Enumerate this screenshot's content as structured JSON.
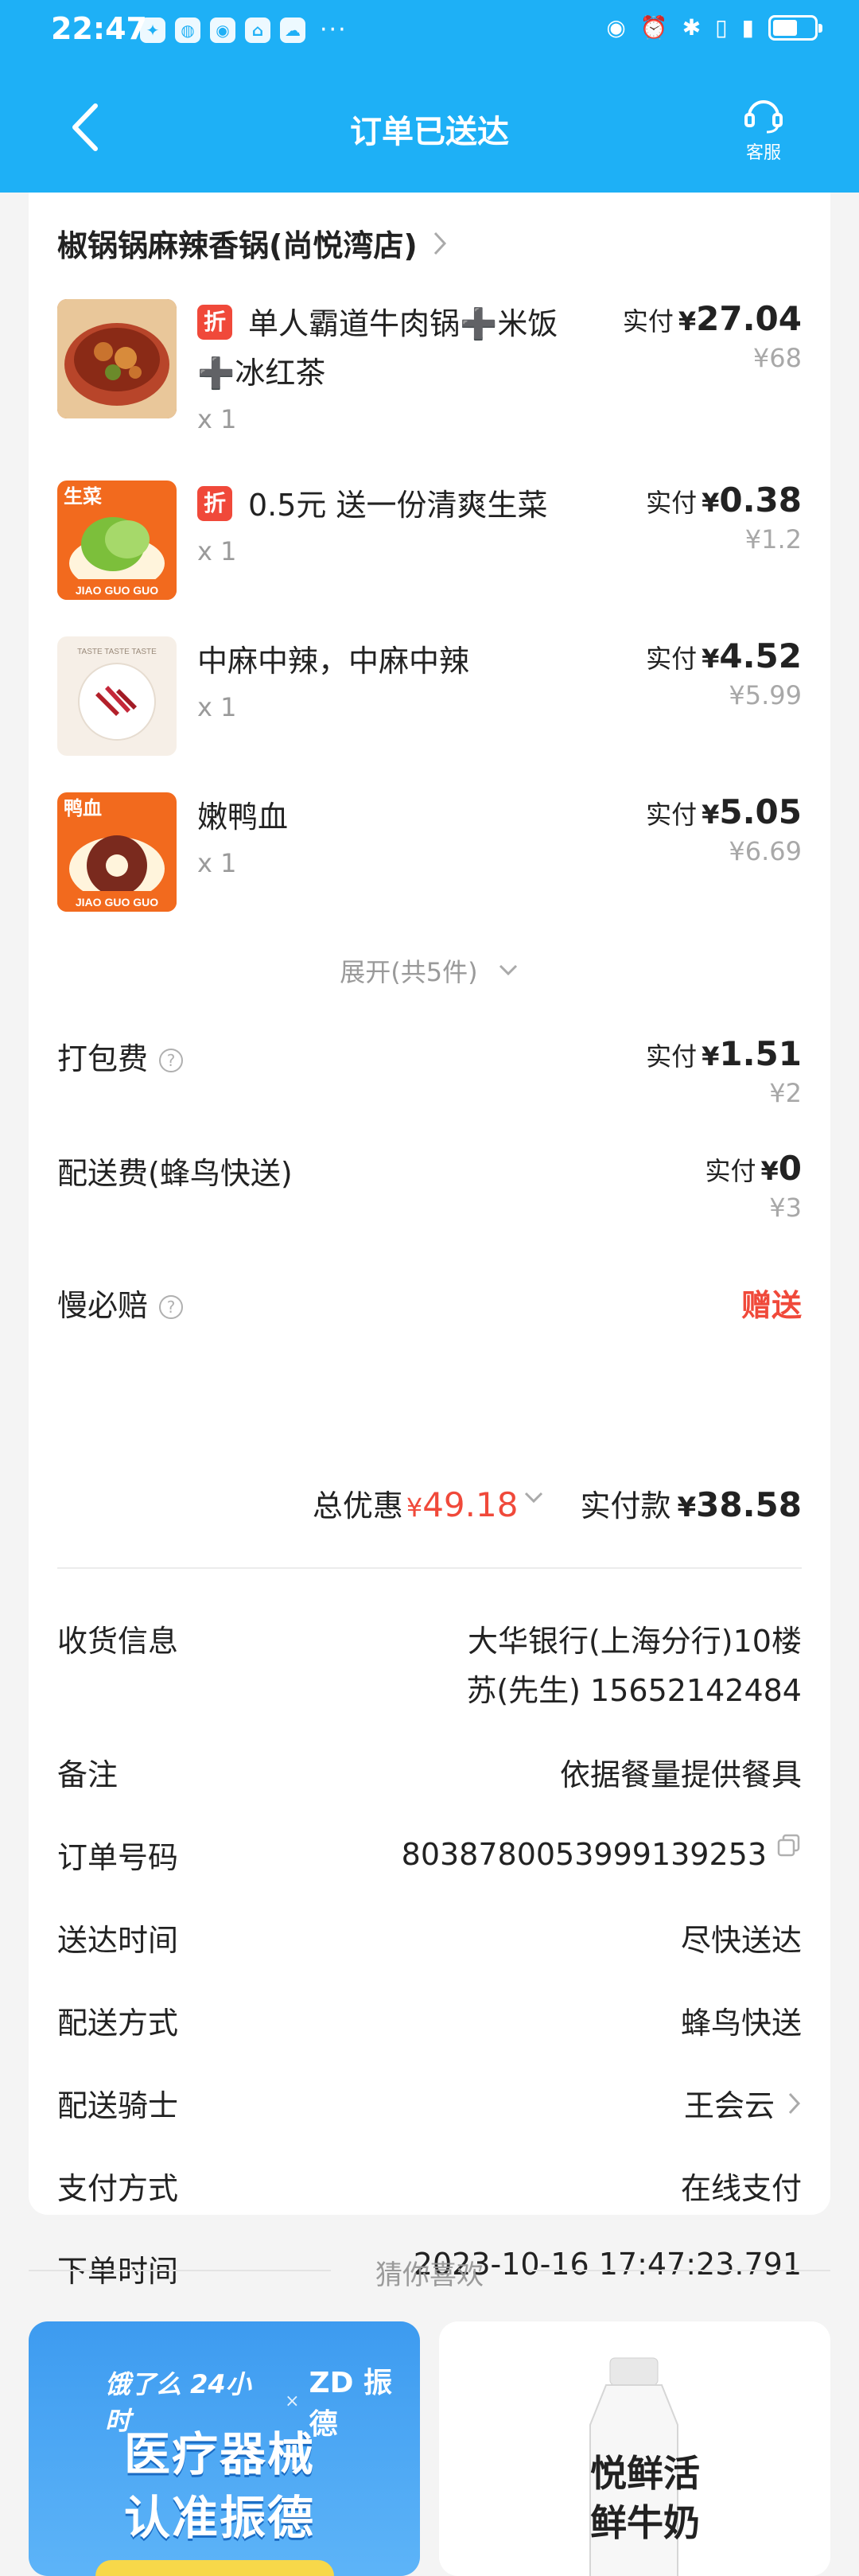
{
  "status_bar": {
    "time": "22:47",
    "left_icons": [
      "bulb-icon",
      "app-icon",
      "app-icon",
      "home-icon",
      "weather-icon"
    ],
    "more": "···",
    "battery_level_percent": 60
  },
  "nav": {
    "title": "订单已送达",
    "service_label": "客服"
  },
  "store": {
    "name": "椒锅锅麻辣香锅(尚悦湾店)"
  },
  "items": [
    {
      "discount_tag": "折",
      "title": "单人霸道牛肉锅➕米饭➕冰红茶",
      "qty": "x 1",
      "paid_label": "实付",
      "currency": "¥",
      "paid": "27.04",
      "original": "¥68"
    },
    {
      "discount_tag": "折",
      "title": "0.5元 送一份清爽生菜",
      "qty": "x 1",
      "paid_label": "实付",
      "currency": "¥",
      "paid": "0.38",
      "original": "¥1.2",
      "thumb_label": "生菜",
      "thumb_brand": "JIAO GUO GUO"
    },
    {
      "title": "中麻中辣，中麻中辣",
      "qty": "x 1",
      "paid_label": "实付",
      "currency": "¥",
      "paid": "4.52",
      "original": "¥5.99",
      "thumb_label": "TASTE  TASTE  TASTE"
    },
    {
      "title": "嫩鸭血",
      "qty": "x 1",
      "paid_label": "实付",
      "currency": "¥",
      "paid": "5.05",
      "original": "¥6.69",
      "thumb_label": "鸭血",
      "thumb_brand": "JIAO GUO GUO"
    }
  ],
  "expand": "展开(共5件)",
  "fees": {
    "packing": {
      "label": "打包费",
      "paid_label": "实付",
      "currency": "¥",
      "paid": "1.51",
      "original": "¥2"
    },
    "delivery": {
      "label": "配送费(蜂鸟快送)",
      "paid_label": "实付",
      "currency": "¥",
      "paid": "0",
      "original": "¥3"
    },
    "slow_comp": {
      "label": "慢必赔",
      "value": "赠送"
    }
  },
  "totals": {
    "discount_label": "总优惠",
    "discount_currency": "¥",
    "discount": "49.18",
    "paid_label": "实付款",
    "paid_currency": "¥",
    "paid": "38.58"
  },
  "info": {
    "address_label": "收货信息",
    "address_line1": "大华银行(上海分行)10楼",
    "address_line2": "苏(先生) 15652142484",
    "remark_label": "备注",
    "remark": "依据餐量提供餐具",
    "order_no_label": "订单号码",
    "order_no": "8038780053999139253",
    "delivered_label": "送达时间",
    "delivered": "尽快送达",
    "method_label": "配送方式",
    "method": "蜂鸟快送",
    "rider_label": "配送骑士",
    "rider": "王会云",
    "payment_label": "支付方式",
    "payment": "在线支付",
    "order_time_label": "下单时间",
    "order_time": "2023-10-16 17:47:23.791"
  },
  "recommend": {
    "title": "猜你喜欢",
    "ad_left": {
      "logo1": "饿了么 24小时",
      "logo2": "ZD 振德",
      "line1": "医疗器械",
      "line2": "认准振德"
    },
    "ad_right": {
      "product_line1": "悦鲜活",
      "product_line2": "鲜牛奶"
    }
  },
  "colors": {
    "header": "#1eb0f6",
    "accent_red": "#f0493a",
    "muted": "#9a9a9a"
  }
}
